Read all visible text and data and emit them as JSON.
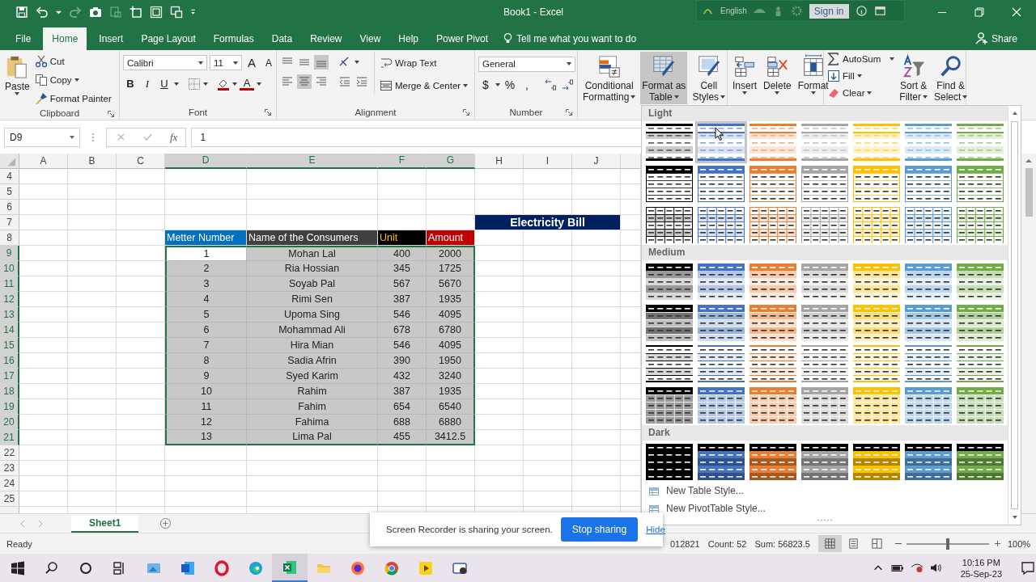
{
  "title_bar": {
    "title": "Book1  -  Excel",
    "language": "English",
    "sign_in": "Sign in"
  },
  "tabs": [
    {
      "label": "File",
      "selected": false
    },
    {
      "label": "Home",
      "selected": true
    },
    {
      "label": "Insert",
      "selected": false
    },
    {
      "label": "Page Layout",
      "selected": false
    },
    {
      "label": "Formulas",
      "selected": false
    },
    {
      "label": "Data",
      "selected": false
    },
    {
      "label": "Review",
      "selected": false
    },
    {
      "label": "View",
      "selected": false
    },
    {
      "label": "Help",
      "selected": false
    },
    {
      "label": "Power Pivot",
      "selected": false
    }
  ],
  "tell_me": "Tell me what you want to do",
  "share": "Share",
  "ribbon": {
    "clipboard": {
      "label": "Clipboard",
      "paste": "Paste",
      "cut": "Cut",
      "copy": "Copy",
      "format_painter": "Format Painter"
    },
    "font": {
      "label": "Font",
      "family": "Calibri",
      "size": "11",
      "grow": "A",
      "shrink": "A",
      "bold": "B",
      "italic": "I",
      "underline": "U",
      "font_color": "A"
    },
    "alignment": {
      "label": "Alignment",
      "wrap": "Wrap Text",
      "merge": "Merge & Center"
    },
    "number": {
      "label": "Number",
      "format": "General",
      "currency": "$",
      "percent": "%",
      "comma": ","
    },
    "styles": [
      {
        "lines": [
          "Conditional",
          "Formatting"
        ],
        "selected": false
      },
      {
        "lines": [
          "Format as",
          "Table"
        ],
        "selected": true
      },
      {
        "lines": [
          "Cell",
          "Styles"
        ],
        "selected": false
      }
    ],
    "cells": [
      "Insert",
      "Delete",
      "Format"
    ],
    "editing": {
      "autosum": "AutoSum",
      "fill": "Fill",
      "clear": "Clear",
      "sort": [
        "Sort &",
        "Filter"
      ],
      "find": [
        "Find &",
        "Select"
      ]
    }
  },
  "formula_bar": {
    "name_box": "D9",
    "function_label": "fx",
    "value": "1"
  },
  "sheet": {
    "columns": [
      {
        "label": "A",
        "selected": false
      },
      {
        "label": "B",
        "selected": false
      },
      {
        "label": "C",
        "selected": false
      },
      {
        "label": "D",
        "selected": true
      },
      {
        "label": "E",
        "selected": true
      },
      {
        "label": "F",
        "selected": true
      },
      {
        "label": "G",
        "selected": true
      },
      {
        "label": "H",
        "selected": false
      },
      {
        "label": "I",
        "selected": false
      },
      {
        "label": "J",
        "selected": false
      }
    ],
    "rows": [
      {
        "label": "4",
        "selected": false
      },
      {
        "label": "5",
        "selected": false
      },
      {
        "label": "6",
        "selected": false
      },
      {
        "label": "7",
        "selected": false
      },
      {
        "label": "8",
        "selected": false
      },
      {
        "label": "9",
        "selected": true
      },
      {
        "label": "10",
        "selected": true
      },
      {
        "label": "11",
        "selected": true
      },
      {
        "label": "12",
        "selected": true
      },
      {
        "label": "13",
        "selected": true
      },
      {
        "label": "14",
        "selected": true
      },
      {
        "label": "15",
        "selected": true
      },
      {
        "label": "16",
        "selected": true
      },
      {
        "label": "17",
        "selected": true
      },
      {
        "label": "18",
        "selected": true
      },
      {
        "label": "19",
        "selected": true
      },
      {
        "label": "20",
        "selected": true
      },
      {
        "label": "21",
        "selected": true
      },
      {
        "label": "22",
        "selected": false
      },
      {
        "label": "23",
        "selected": false
      },
      {
        "label": "24",
        "selected": false
      },
      {
        "label": "25",
        "selected": false
      }
    ],
    "title": "Electricity Bill",
    "table": {
      "header": [
        {
          "text": "Metter Number",
          "color": "#0070c0"
        },
        {
          "text": "Name of the Consumers",
          "color": "#404040"
        },
        {
          "text": "Unit",
          "color": "#000000"
        },
        {
          "text": "Amount",
          "color": "#c00000"
        }
      ],
      "rows": [
        [
          "1",
          "Mohan Lal",
          "400",
          "2000"
        ],
        [
          "2",
          "Ria Hossian",
          "345",
          "1725"
        ],
        [
          "3",
          "Soyab Pal",
          "567",
          "5670"
        ],
        [
          "4",
          "Rimi Sen",
          "387",
          "1935"
        ],
        [
          "5",
          "Upoma Sing",
          "546",
          "4095"
        ],
        [
          "6",
          "Mohammad Ali",
          "678",
          "6780"
        ],
        [
          "7",
          "Hira Mian",
          "546",
          "4095"
        ],
        [
          "8",
          "Sadia Afrin",
          "390",
          "1950"
        ],
        [
          "9",
          "Syed Karim",
          "432",
          "3240"
        ],
        [
          "10",
          "Rahim",
          "387",
          "1935"
        ],
        [
          "11",
          "Fahim",
          "654",
          "6540"
        ],
        [
          "12",
          "Fahima",
          "688",
          "6880"
        ],
        [
          "13",
          "Lima Pal",
          "455",
          "3412.5"
        ]
      ]
    }
  },
  "sheet_tabs": [
    {
      "label": "Sheet1",
      "selected": true
    }
  ],
  "status_bar": {
    "mode": "Ready",
    "average": "012821",
    "count": "Count: 52",
    "sum": "Sum: 56823.5",
    "zoom": "100%",
    "level": 0.5
  },
  "screen_share": {
    "message": "Screen Recorder is sharing your screen.",
    "stop": "Stop sharing",
    "hide": "Hide"
  },
  "gallery": {
    "sections": [
      {
        "title": "Light",
        "rows": [
          {
            "kind": "light-lines",
            "swatches": [
              {
                "color": "#000000",
                "selected": false
              },
              {
                "color": "#4472c4",
                "selected": true
              },
              {
                "color": "#ed7d31",
                "selected": false
              },
              {
                "color": "#a5a5a5",
                "selected": false
              },
              {
                "color": "#ffc000",
                "selected": false
              },
              {
                "color": "#5b9bd5",
                "selected": false
              },
              {
                "color": "#70ad47",
                "selected": false
              }
            ]
          },
          {
            "kind": "light-header",
            "swatches": [
              {
                "color": "#000000",
                "selected": false
              },
              {
                "color": "#4472c4",
                "selected": false
              },
              {
                "color": "#ed7d31",
                "selected": false
              },
              {
                "color": "#a5a5a5",
                "selected": false
              },
              {
                "color": "#ffc000",
                "selected": false
              },
              {
                "color": "#5b9bd5",
                "selected": false
              },
              {
                "color": "#70ad47",
                "selected": false
              }
            ]
          },
          {
            "kind": "light-grid",
            "swatches": [
              {
                "color": "#000000",
                "selected": false
              },
              {
                "color": "#4472c4",
                "selected": false
              },
              {
                "color": "#ed7d31",
                "selected": false
              },
              {
                "color": "#a5a5a5",
                "selected": false
              },
              {
                "color": "#ffc000",
                "selected": false
              },
              {
                "color": "#5b9bd5",
                "selected": false
              },
              {
                "color": "#70ad47",
                "selected": false
              }
            ]
          }
        ]
      },
      {
        "title": "Medium",
        "rows": [
          {
            "kind": "medium-header",
            "swatches": [
              {
                "color": "#000000",
                "selected": false
              },
              {
                "color": "#4472c4",
                "selected": false
              },
              {
                "color": "#ed7d31",
                "selected": false
              },
              {
                "color": "#a5a5a5",
                "selected": false
              },
              {
                "color": "#ffc000",
                "selected": false
              },
              {
                "color": "#5b9bd5",
                "selected": false
              },
              {
                "color": "#70ad47",
                "selected": false
              }
            ]
          },
          {
            "kind": "medium-banded",
            "swatches": [
              {
                "color": "#000000",
                "selected": false
              },
              {
                "color": "#4472c4",
                "selected": false
              },
              {
                "color": "#ed7d31",
                "selected": false
              },
              {
                "color": "#a5a5a5",
                "selected": false
              },
              {
                "color": "#ffc000",
                "selected": false
              },
              {
                "color": "#5b9bd5",
                "selected": false
              },
              {
                "color": "#70ad47",
                "selected": false
              }
            ]
          },
          {
            "kind": "medium-bordered",
            "swatches": [
              {
                "color": "#000000",
                "selected": false
              },
              {
                "color": "#4472c4",
                "selected": false
              },
              {
                "color": "#ed7d31",
                "selected": false
              },
              {
                "color": "#a5a5a5",
                "selected": false
              },
              {
                "color": "#ffc000",
                "selected": false
              },
              {
                "color": "#5b9bd5",
                "selected": false
              },
              {
                "color": "#70ad47",
                "selected": false
              }
            ]
          },
          {
            "kind": "medium-block",
            "swatches": [
              {
                "color": "#000000",
                "selected": false
              },
              {
                "color": "#4472c4",
                "selected": false
              },
              {
                "color": "#ed7d31",
                "selected": false
              },
              {
                "color": "#a5a5a5",
                "selected": false
              },
              {
                "color": "#ffc000",
                "selected": false
              },
              {
                "color": "#5b9bd5",
                "selected": false
              },
              {
                "color": "#70ad47",
                "selected": false
              }
            ]
          }
        ]
      },
      {
        "title": "Dark",
        "rows": [
          {
            "kind": "dark",
            "swatches": [
              {
                "color": "#000000",
                "selected": false
              },
              {
                "color": "#4472c4",
                "selected": false
              },
              {
                "color": "#ed7d31",
                "selected": false
              },
              {
                "color": "#a5a5a5",
                "selected": false
              },
              {
                "color": "#ffc000",
                "selected": false
              },
              {
                "color": "#5b9bd5",
                "selected": false
              },
              {
                "color": "#70ad47",
                "selected": false
              }
            ]
          }
        ]
      }
    ],
    "footer": [
      "New Table Style...",
      "New PivotTable Style..."
    ]
  },
  "taskbar": {
    "time": "10:16 PM",
    "date": "25-Sep-23"
  }
}
